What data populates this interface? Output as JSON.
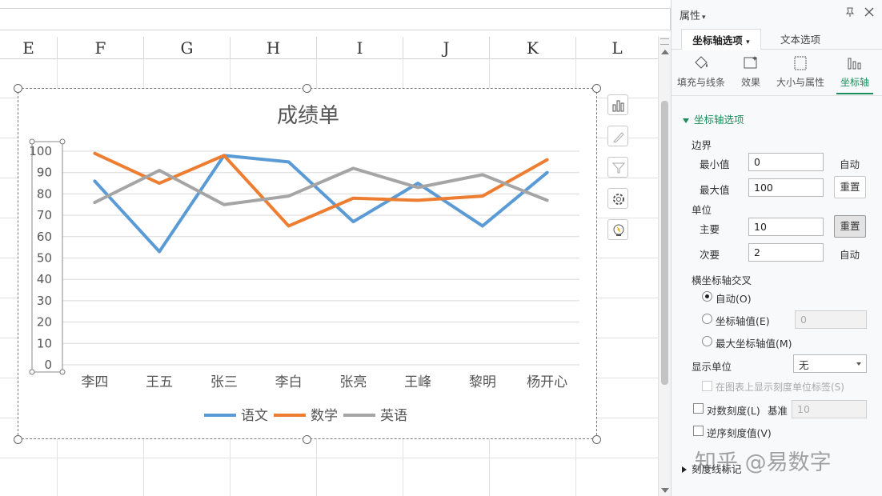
{
  "sheet": {
    "columns": [
      "E",
      "F",
      "G",
      "H",
      "I",
      "J",
      "K",
      "L"
    ]
  },
  "chart_data": {
    "type": "line",
    "title": "成绩单",
    "categories": [
      "李四",
      "王五",
      "张三",
      "李白",
      "张亮",
      "王峰",
      "黎明",
      "杨开心"
    ],
    "series": [
      {
        "name": "语文",
        "color": "#5b9bd5",
        "values": [
          86,
          53,
          98,
          95,
          67,
          85,
          65,
          90
        ]
      },
      {
        "name": "数学",
        "color": "#ed7d31",
        "values": [
          99,
          85,
          98,
          65,
          78,
          77,
          79,
          96
        ]
      },
      {
        "name": "英语",
        "color": "#a5a5a5",
        "values": [
          76,
          91,
          75,
          79,
          92,
          83,
          89,
          77
        ]
      }
    ],
    "ylim": [
      0,
      100
    ],
    "y_ticks": [
      "0",
      "10",
      "20",
      "30",
      "40",
      "50",
      "60",
      "70",
      "80",
      "90",
      "100"
    ],
    "grid": true,
    "legend": "bottom"
  },
  "chart_tools": [
    "chart-elements-icon",
    "chart-style-icon",
    "chart-filter-icon",
    "chart-settings-icon",
    "chart-tips-icon"
  ],
  "pane": {
    "title": "属性",
    "tabs": {
      "axis_options": "坐标轴选项",
      "text_options": "文本选项"
    },
    "categories": {
      "fill": "填充与线条",
      "effects": "效果",
      "size": "大小与属性",
      "axis": "坐标轴"
    },
    "section": "坐标轴选项",
    "bounds_label": "边界",
    "min_label": "最小值",
    "min_value": "0",
    "min_status": "自动",
    "max_label": "最大值",
    "max_value": "100",
    "max_button": "重置",
    "units_label": "单位",
    "major_label": "主要",
    "major_value": "10",
    "major_button": "重置",
    "minor_label": "次要",
    "minor_value": "2",
    "minor_status": "自动",
    "cross_label": "横坐标轴交叉",
    "cross_auto": "自动(O)",
    "cross_value": "坐标轴值(E)",
    "cross_value_input": "0",
    "cross_max": "最大坐标轴值(M)",
    "display_units_label": "显示单位",
    "display_units_value": "无",
    "show_units_label": "在图表上显示刻度单位标签(S)",
    "log_label": "对数刻度(L)",
    "base_label": "基准",
    "base_value": "10",
    "reverse_label": "逆序刻度值(V)",
    "tickmarks_label": "刻度线标记"
  },
  "watermark": "知乎 @易数字"
}
